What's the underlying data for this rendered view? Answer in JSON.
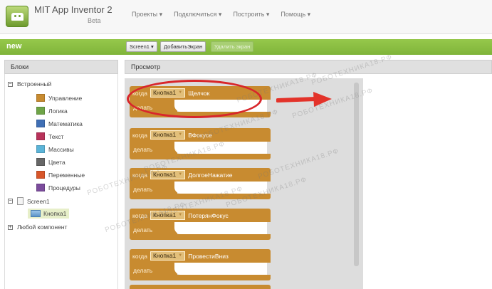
{
  "header": {
    "app_name": "MIT App Inventor 2",
    "app_version": "Beta",
    "menu": [
      "Проекты ▾",
      "Подключиться ▾",
      "Построить ▾",
      "Помощь ▾"
    ]
  },
  "toolbar": {
    "project_name": "new",
    "screen_select": "Screen1 ▾",
    "add_screen": "ДобавитьЭкран",
    "remove_screen": "Удалить экран"
  },
  "panels": {
    "blocks_title": "Блоки",
    "preview_title": "Просмотр"
  },
  "tree": {
    "builtin": "Встроенный",
    "builtin_items": [
      {
        "label": "Управление",
        "color": "#c88b30"
      },
      {
        "label": "Логика",
        "color": "#6ea447"
      },
      {
        "label": "Математика",
        "color": "#3f6fb5"
      },
      {
        "label": "Текст",
        "color": "#b8325a"
      },
      {
        "label": "Массивы",
        "color": "#5bb4d8"
      },
      {
        "label": "Цвета",
        "color": "#666666"
      },
      {
        "label": "Переменные",
        "color": "#d8562a"
      },
      {
        "label": "Процедуры",
        "color": "#7b4c9c"
      }
    ],
    "screen": "Screen1",
    "component": "Кнопка1",
    "any_component": "Любой компонент"
  },
  "blocks": [
    {
      "when": "когда",
      "component": "Кнопка1",
      "event": "Щелчок",
      "do": "делать"
    },
    {
      "when": "когда",
      "component": "Кнопка1",
      "event": "ВФокусе",
      "do": "делать"
    },
    {
      "when": "когда",
      "component": "Кнопка1",
      "event": "ДолгоеНажатие",
      "do": "делать"
    },
    {
      "when": "когда",
      "component": "Кнопка1",
      "event": "ПотерянФокус",
      "do": "делать"
    },
    {
      "when": "когда",
      "component": "Кнопка1",
      "event": "ПровестиВниз",
      "do": "делать"
    }
  ],
  "watermark": "РОБОТЕХНИКА18.РФ"
}
